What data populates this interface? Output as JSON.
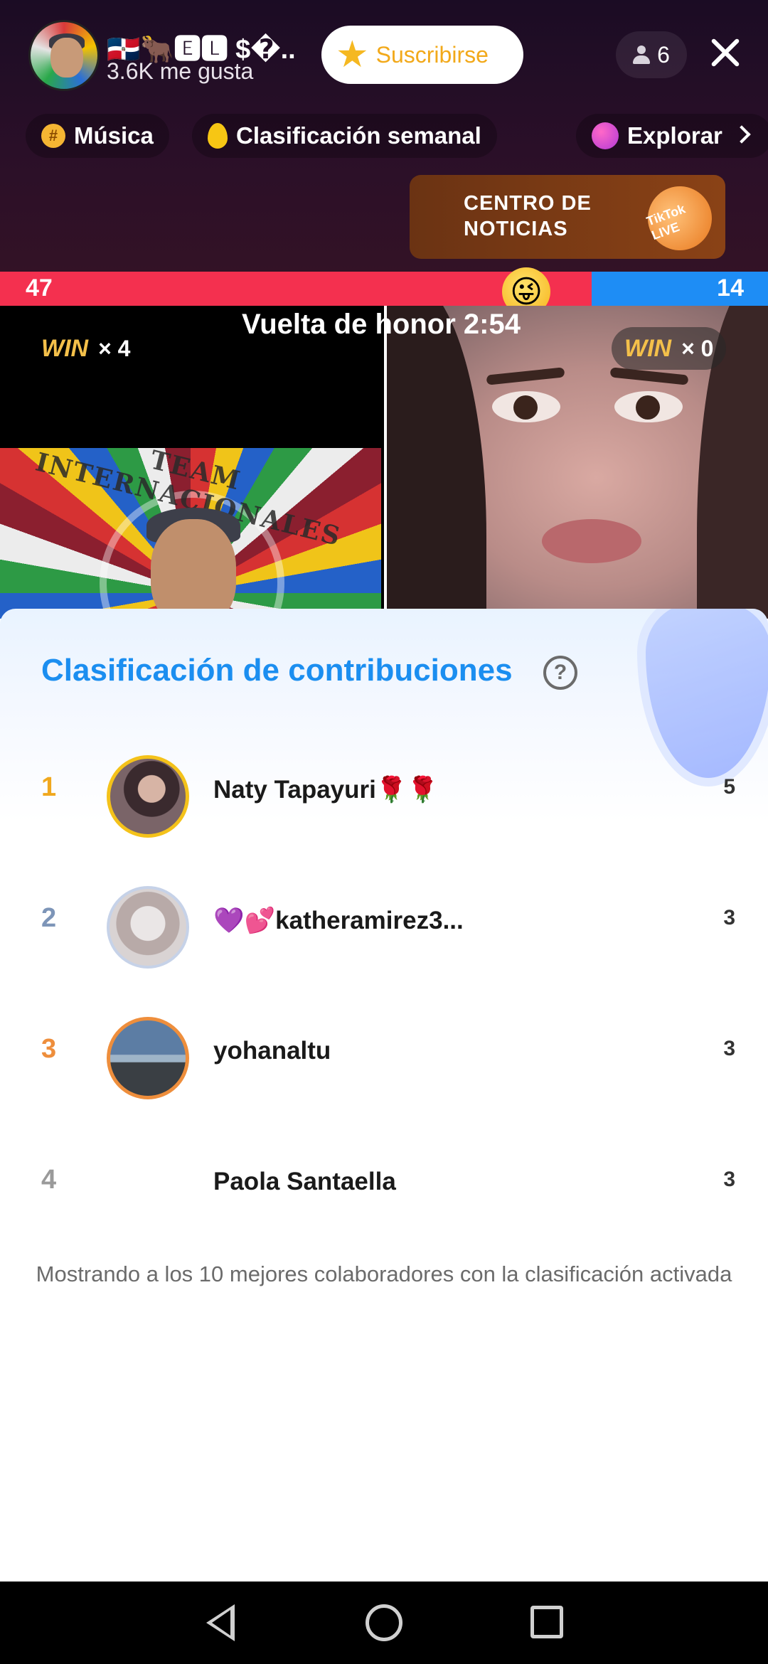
{
  "header": {
    "host_name": "🇩🇴🐂🅴🅻 $�..",
    "likes": "3.6K me gusta",
    "subscribe_label": "Suscribirse",
    "viewer_count": "6"
  },
  "chips": {
    "musica": "Música",
    "weekly_rank": "Clasificación semanal",
    "explore": "Explorar"
  },
  "news_banner": {
    "text": "CENTRO DE NOTICIAS",
    "logo_text": "TikTok LIVE"
  },
  "battle": {
    "score_left": "47",
    "score_right": "14",
    "left_share": 0.77,
    "timer": "Vuelta de honor 2:54",
    "left_win_label": "WIN",
    "left_win_count": "× 4",
    "right_win_label": "WIN",
    "right_win_count": "× 0",
    "left_overlay_text": "TEAM INTERNACIONALES"
  },
  "leaderboard": {
    "title": "Clasificación de contribuciones",
    "rows": [
      {
        "rank": "1",
        "name": "Naty Tapayuri🌹🌹",
        "score": "5",
        "rank_color": "#f0a81e"
      },
      {
        "rank": "2",
        "name": "💜💕katheramirez3...",
        "score": "3",
        "rank_color": "#7d95b8"
      },
      {
        "rank": "3",
        "name": "yohanaltu",
        "score": "3",
        "rank_color": "#ee8e3c"
      },
      {
        "rank": "4",
        "name": "Paola Santaella",
        "score": "3",
        "rank_color": "#9a9a9a"
      }
    ],
    "footer_note": "Mostrando a los 10 mejores colaboradores con la clasificación activada"
  },
  "colors": {
    "accent_blue": "#1b8ef0",
    "score_red": "#f4304f",
    "score_blue": "#1e8df5",
    "subscribe_text": "#f2a91a"
  },
  "icons": [
    "star-icon",
    "person-icon",
    "close-icon",
    "hash-icon",
    "flame-icon",
    "planet-icon",
    "chevron-right-icon",
    "help-icon",
    "back-icon",
    "home-icon",
    "recents-icon"
  ]
}
